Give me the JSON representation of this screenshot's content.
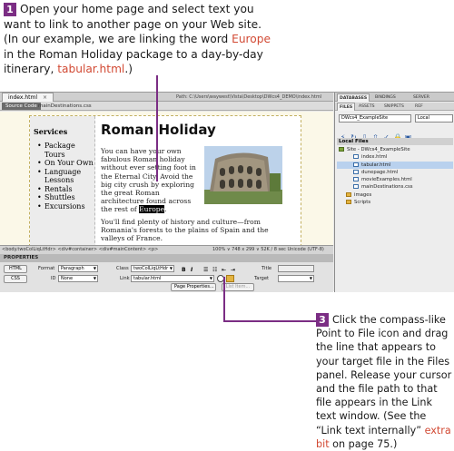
{
  "callout_top": {
    "step": "1",
    "text_a": "Open your home page and select text you want to link to another page on your Web site. (In our example, we are linking the word ",
    "highlight_word": "Europe",
    "text_b": " in the Roman Holiday package to a day-by-day itinerary, ",
    "highlight_file": "tabular.html",
    "text_c": ".)"
  },
  "callout_bottom": {
    "step": "3",
    "text_a": "Click the compass-like Point to File icon and drag the line that appears to your target file in the Files panel. Release your cursor and the file path to that file appears in the Link text window. (See the “Link text internally” ",
    "highlight": "extra bit",
    "text_b": " on page 75.)"
  },
  "editor": {
    "doc_tab": "index.html",
    "close_glyph": "×",
    "path_label": "Path:",
    "path_value": "C:\\Users\\waywest\\Vista\\Desktop\\DWcs4_DEMO\\index.html",
    "source_btn": "Source Code",
    "related_file": "mainDestinations.css"
  },
  "webpage": {
    "sidebar_title": "Services",
    "sidebar_items": [
      "Package Tours",
      "On Your Own",
      "Language Lessons",
      "Rentals",
      "Shuttles",
      "Excursions"
    ],
    "title": "Roman Holiday",
    "para1_before": "You can have your own fabulous Roman holiday without ever setting foot in the Eternal City. Avoid the big city crush by exploring the great Roman architecture found across the rest of ",
    "para1_selected": "Europe",
    "para1_after": ".",
    "para2": "You'll find plenty of history and culture—from Romania's forests to the plains of Spain and the valleys of France."
  },
  "status_bar": {
    "tags": "<body.twoColLiqLtHdr> <div#container> <div#mainContent> <p>",
    "zoom": "100% ∨ 748 x 299 ∨ 52K / 8 sec  Unicode (UTF-8)"
  },
  "properties": {
    "header": "PROPERTIES",
    "html_btn": "HTML",
    "css_btn": "CSS",
    "format_label": "Format",
    "format_value": "Paragraph",
    "id_label": "ID",
    "id_value": "None",
    "class_label": "Class",
    "class_value": "twoColLiqLtHdr",
    "link_label": "Link",
    "link_value": "tabular.html",
    "bold": "B",
    "italic": "I",
    "title_label": "Title",
    "target_label": "Target",
    "page_props_btn": "Page Properties...",
    "list_item_btn": "List Item..."
  },
  "files_panel": {
    "tabs": [
      "DATABASES",
      "BINDINGS",
      "SERVER"
    ],
    "tabs2": [
      "FILES",
      "ASSETS",
      "SNIPPETS",
      "REF"
    ],
    "site_select": "DWcs4_ExampleSite",
    "view_select": "Local",
    "local_files_label": "Local Files",
    "tree": [
      {
        "name": "Site - DWcs4_ExampleSite",
        "type": "site",
        "indent": 0
      },
      {
        "name": "index.html",
        "type": "page",
        "indent": 2
      },
      {
        "name": "tabular.html",
        "type": "page",
        "indent": 2,
        "selected": true
      },
      {
        "name": "dunepage.html",
        "type": "page",
        "indent": 2
      },
      {
        "name": "movieExamples.html",
        "type": "page",
        "indent": 2
      },
      {
        "name": "mainDestinations.css",
        "type": "page",
        "indent": 2
      },
      {
        "name": "images",
        "type": "folder",
        "indent": 1
      },
      {
        "name": "Scripts",
        "type": "folder",
        "indent": 1
      }
    ]
  }
}
